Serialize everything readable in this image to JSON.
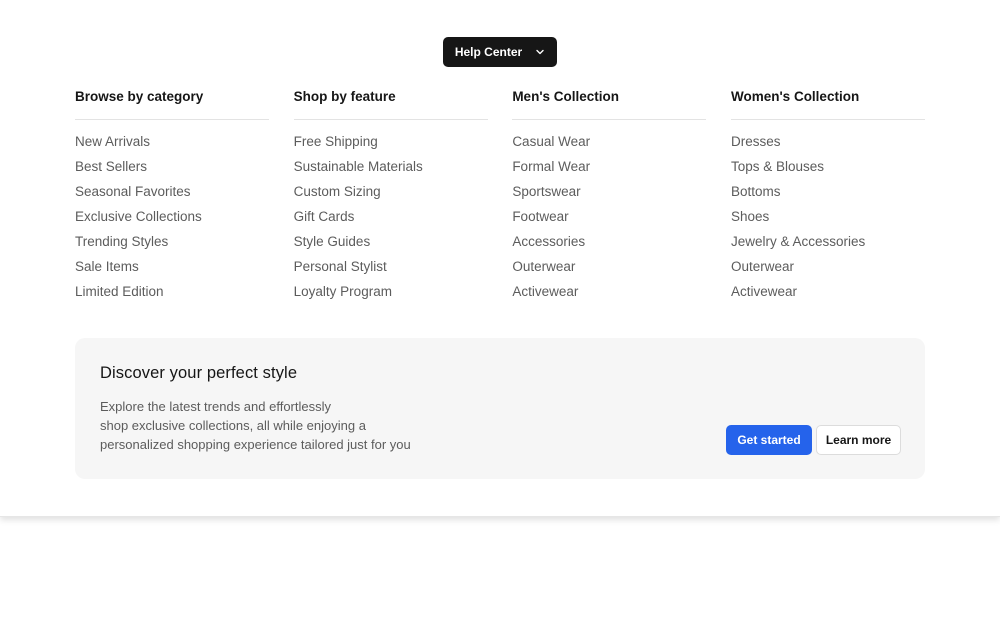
{
  "header": {
    "help_center_label": "Help Center",
    "help_center_icon": "chevron-down-icon"
  },
  "columns": [
    {
      "title": "Browse by category",
      "items": [
        "New Arrivals",
        "Best Sellers",
        "Seasonal Favorites",
        "Exclusive Collections",
        "Trending Styles",
        "Sale Items",
        "Limited Edition"
      ]
    },
    {
      "title": "Shop by feature",
      "items": [
        "Free Shipping",
        "Sustainable Materials",
        "Custom Sizing",
        "Gift Cards",
        "Style Guides",
        "Personal Stylist",
        "Loyalty Program"
      ]
    },
    {
      "title": "Men's Collection",
      "items": [
        "Casual Wear",
        "Formal Wear",
        "Sportswear",
        "Footwear",
        "Accessories",
        "Outerwear",
        "Activewear"
      ]
    },
    {
      "title": "Women's Collection",
      "items": [
        "Dresses",
        "Tops & Blouses",
        "Bottoms",
        "Shoes",
        "Jewelry & Accessories",
        "Outerwear",
        "Activewear"
      ]
    }
  ],
  "promo": {
    "title": "Discover your perfect style",
    "text_lines": [
      "Explore the latest trends and effortlessly",
      "shop exclusive collections, all while enjoying a",
      "personalized shopping experience tailored just for you"
    ],
    "primary_label": "Get started",
    "secondary_label": "Learn more"
  },
  "colors": {
    "primary": "#2563eb",
    "dark_button": "#161616",
    "promo_bg": "#f6f6f6",
    "link_text": "#5c5c5c"
  }
}
